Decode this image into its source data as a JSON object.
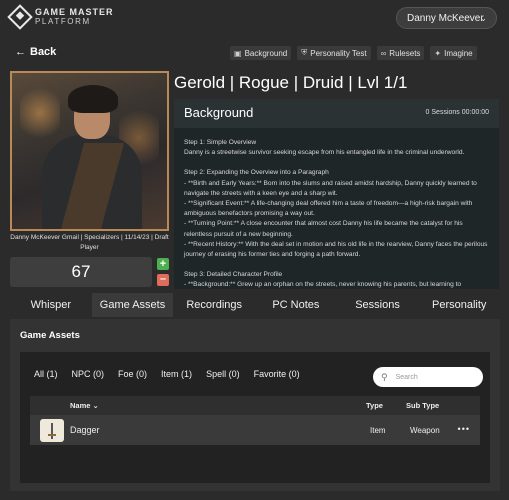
{
  "app": {
    "logo_line1": "GAME MASTER",
    "logo_line2": "PLATFORM",
    "user_name": "Danny McKeever"
  },
  "nav": {
    "back_label": "Back"
  },
  "toolbar": [
    {
      "label": "Background",
      "icon": "image-icon"
    },
    {
      "label": "Personality Test",
      "icon": "shield-icon"
    },
    {
      "label": "Rulesets",
      "icon": "link-icon"
    },
    {
      "label": "Imagine",
      "icon": "sparkle-icon"
    }
  ],
  "character": {
    "title": "Gerold  | Rogue | Druid | Lvl 1/1",
    "caption": "Danny McKeever Gmail | Specializers | 11/14/23 | Draft Player",
    "score": "67"
  },
  "background": {
    "title": "Background",
    "sessions": "0 Sessions",
    "time": "00:00:00",
    "lines": [
      "Step 1: Simple Overview",
      "Danny is a streetwise survivor seeking escape from his entangled life in the criminal underworld.",
      "",
      "Step 2: Expanding the Overview into a Paragraph",
      "- **Birth and Early Years:** Born into the slums and raised amidst hardship, Danny quickly learned to navigate the streets with a keen eye and a sharp wit.",
      "- **Significant Event:** A life-changing deal offered him a taste of freedom—a high-risk bargain with ambiguous benefactors promising a way out.",
      "- **Turning Point:** A close encounter that almost cost Danny his life became the catalyst for his relentless pursuit of a new beginning.",
      "- **Recent History:** With the deal set in motion and his old life in the rearview, Danny faces the perilous journey of erasing his former ties and forging a path forward.",
      "",
      "Step 3: Detailed Character Profile",
      "- **Background:** Grew up an orphan on the streets, never knowing his parents, but learning to"
    ]
  },
  "tabs": [
    "Whisper",
    "Game Assets",
    "Recordings",
    "PC Notes",
    "Sessions",
    "Personality"
  ],
  "active_tab": "Game Assets",
  "assets": {
    "heading": "Game Assets",
    "filters": [
      "All (1)",
      "NPC (0)",
      "Foe (0)",
      "Item (1)",
      "Spell (0)",
      "Favorite (0)"
    ],
    "search_placeholder": "Search",
    "columns": {
      "name": "Name",
      "type": "Type",
      "subtype": "Sub Type"
    },
    "rows": [
      {
        "name": "Dagger",
        "type": "Item",
        "subtype": "Weapon"
      }
    ]
  },
  "colors": {
    "accent_green": "#4caf50",
    "accent_red": "#e06c5b",
    "portrait_frame": "#b98a55"
  }
}
